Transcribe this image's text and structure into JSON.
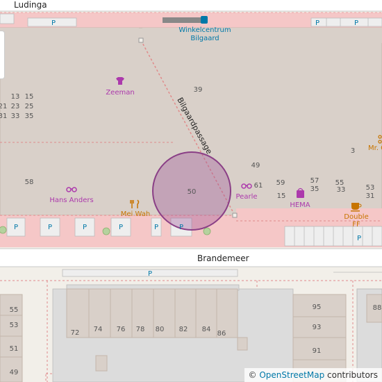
{
  "streets": {
    "north": "Ludinga",
    "south": "Brandemeer",
    "passage": "Bilgaardpassage"
  },
  "places": {
    "shopping_center": "Winkelcentrum Bilgaard",
    "zeeman": "Zeeman",
    "hans_anders": "Hans Anders",
    "mei_wah": "Mei Wah",
    "pearle": "Pearle",
    "hema": "HEMA",
    "double_ff": "Double FF",
    "mr_cut": "Mr. C"
  },
  "parking_label": "P",
  "house_numbers_center": {
    "n13": "13",
    "n15": "15",
    "n21": "21",
    "n23": "23",
    "n25": "25",
    "n31": "31",
    "n33": "33",
    "n35": "35",
    "n39": "39",
    "n49": "49",
    "n58": "58",
    "n50": "50",
    "n61": "61",
    "n59": "59",
    "n57": "57",
    "n55": "55",
    "n53": "53",
    "n15b": "15",
    "n35b": "35",
    "n33b": "33",
    "n31b": "31",
    "n3": "3"
  },
  "house_numbers_south": {
    "n72": "72",
    "n74": "74",
    "n76": "76",
    "n78": "78",
    "n80": "80",
    "n82": "82",
    "n84": "84",
    "n86": "86",
    "n55": "55",
    "n53": "53",
    "n51": "51",
    "n49": "49",
    "n95": "95",
    "n93": "93",
    "n91": "91",
    "n88": "88"
  },
  "attribution": {
    "prefix": "©",
    "link": "OpenStreetMap",
    "suffix": "contributors"
  },
  "colors": {
    "background": "#f2efe9",
    "building": "#d9d0c9",
    "building_stroke": "#c4b6ab",
    "pedestrian": "#f5c7c7",
    "road": "#ffffff",
    "parking": "#eeeeee",
    "poi_purple": "#ac39ac",
    "poi_brown": "#c77400",
    "label_gray": "#555555",
    "marker_circle": "#9b4f96"
  }
}
